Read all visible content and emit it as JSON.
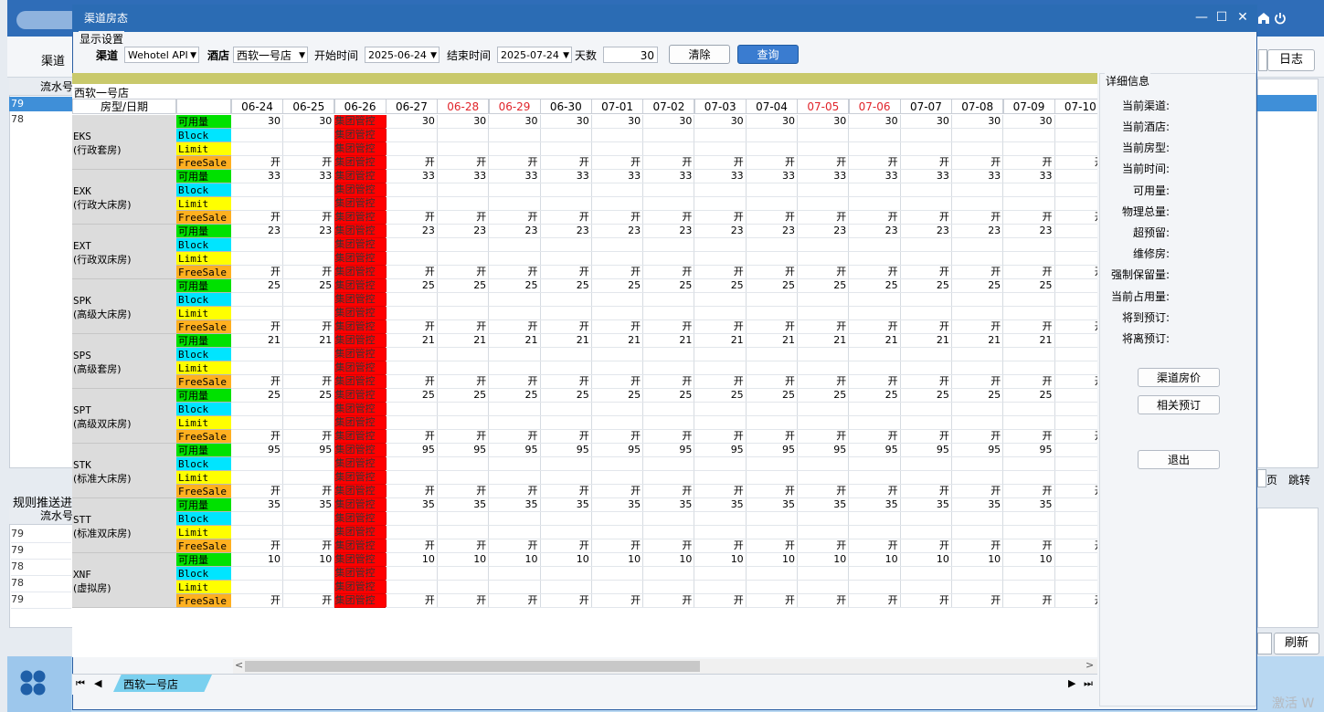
{
  "background": {
    "channel_label": "渠道",
    "log_button": "日志",
    "serial_header": "流水号",
    "selected_row": "79",
    "second_row": "78",
    "page_label": "页",
    "jump_label": "跳转",
    "rules_title": "规则推送进度",
    "serial_header_2": "流水号",
    "rows2": [
      "79",
      "79",
      "78",
      "78",
      "79"
    ],
    "refresh_button": "刷新",
    "watermark": "激活 W"
  },
  "dialog": {
    "title": "渠道房态",
    "minimize": "—",
    "maximize": "☐",
    "close": "✕"
  },
  "settings": {
    "legend": "显示设置",
    "channel_label": "渠道",
    "channel_value": "Wehotel API",
    "hotel_label": "酒店",
    "hotel_value": "西软一号店",
    "start_label": "开始时间",
    "start_value": "2025-06-24",
    "end_label": "结束时间",
    "end_value": "2025-07-24",
    "days_label": "天数",
    "days_value": "30",
    "clear_button": "清除",
    "query_button": "查询"
  },
  "grid": {
    "hotel_caption": "西软一号店",
    "corner_header": "房型/日期",
    "row_types": [
      "可用量",
      "Block",
      "Limit",
      "FreeSale"
    ],
    "row_type_colors": [
      "#00e100",
      "#00e5ff",
      "#ffff00",
      "#ffb020"
    ],
    "control_text": "集团管控",
    "open_text": "开",
    "dates": [
      "06-24",
      "06-25",
      "06-26",
      "06-27",
      "06-28",
      "06-29",
      "06-30",
      "07-01",
      "07-02",
      "07-03",
      "07-04",
      "07-05",
      "07-06",
      "07-07",
      "07-08",
      "07-09",
      "07-10"
    ],
    "weekend_dates": [
      "06-28",
      "06-29",
      "07-05",
      "07-06"
    ],
    "control_date_index": 2,
    "rooms": [
      {
        "code": "EKS",
        "name": "(行政套房)",
        "available": "30"
      },
      {
        "code": "EXK",
        "name": "(行政大床房)",
        "available": "33"
      },
      {
        "code": "EXT",
        "name": "(行政双床房)",
        "available": "23"
      },
      {
        "code": "SPK",
        "name": "(高级大床房)",
        "available": "25"
      },
      {
        "code": "SPS",
        "name": "(高级套房)",
        "available": "21"
      },
      {
        "code": "SPT",
        "name": "(高级双床房)",
        "available": "25"
      },
      {
        "code": "STK",
        "name": "(标准大床房)",
        "available": "95"
      },
      {
        "code": "STT",
        "name": "(标准双床房)",
        "available": "35"
      },
      {
        "code": "XNF",
        "name": "(虚拟房)",
        "available": "10"
      }
    ],
    "last_col_available_partial": [
      "3",
      "3",
      "2",
      "2",
      "2",
      "2",
      "9",
      "3",
      "1"
    ],
    "last_col_open_partial": "开"
  },
  "tabs": {
    "hotel_tab": "西软一号店"
  },
  "detail": {
    "title": "详细信息",
    "labels": [
      "当前渠道:",
      "当前酒店:",
      "当前房型:",
      "当前时间:",
      "可用量:",
      "物理总量:",
      "超预留:",
      "维修房:",
      "强制保留量:",
      "当前占用量:",
      "将到预订:",
      "将离预订:"
    ],
    "price_button": "渠道房价",
    "booking_button": "相关预订",
    "exit_button": "退出"
  },
  "colors": {
    "title_bar": "#2b6cb4",
    "control_red": "#ff0000",
    "weekend_red": "#e0242a",
    "query_blue": "#3a7cd0"
  }
}
